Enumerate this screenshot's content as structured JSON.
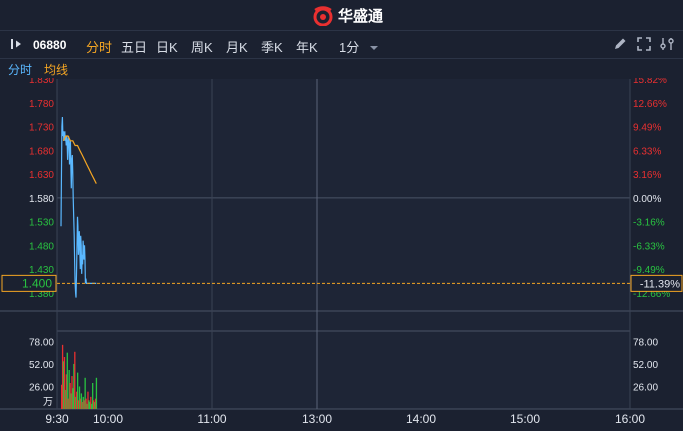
{
  "app": {
    "brand_name": "华盛通"
  },
  "toolbar": {
    "stock_code": "06880",
    "period_tabs": [
      {
        "label": "分时",
        "active": true
      },
      {
        "label": "五日",
        "active": false
      },
      {
        "label": "日K",
        "active": false
      },
      {
        "label": "周K",
        "active": false
      },
      {
        "label": "月K",
        "active": false
      },
      {
        "label": "季K",
        "active": false
      },
      {
        "label": "年K",
        "active": false
      }
    ],
    "interval": "1分",
    "icons": [
      "panel-toggle-icon",
      "pencil-icon",
      "fullscreen-icon",
      "settings-icon"
    ]
  },
  "legend": {
    "time_label": "分时",
    "avg_label": "均线"
  },
  "colors": {
    "up": "#e93030",
    "down": "#29c341",
    "price": "#5ab8ff",
    "avg": "#f5a623",
    "flat": "#e2e6ee"
  },
  "chart_data": {
    "type": "line",
    "price_axis": {
      "ticks": [
        "1.830",
        "1.780",
        "1.730",
        "1.680",
        "1.630",
        "1.580",
        "1.530",
        "1.480",
        "1.430",
        "1.380"
      ],
      "tick_values": [
        1.83,
        1.78,
        1.73,
        1.68,
        1.63,
        1.58,
        1.53,
        1.48,
        1.43,
        1.38
      ],
      "ylim": [
        1.365,
        1.83
      ],
      "prev_close": 1.58
    },
    "percent_axis": {
      "ticks": [
        "15.82%",
        "12.66%",
        "9.49%",
        "6.33%",
        "3.16%",
        "0.00%",
        "-3.16%",
        "-6.33%",
        "-9.49%",
        "-12.66%"
      ]
    },
    "current_price": "1.400",
    "current_change": "-11.39%",
    "x_ticks": [
      "9:30",
      "10:00",
      "11:00",
      "13:00",
      "14:00",
      "15:00",
      "16:00"
    ],
    "volume_axis": {
      "ticks": [
        "78.00",
        "52.00",
        "26.00"
      ],
      "tick_values": [
        78,
        52,
        26
      ],
      "unit": "万",
      "ylim": [
        0,
        90
      ]
    },
    "series": [
      {
        "name": "分时",
        "x": [
          0,
          1,
          2,
          3,
          4,
          5,
          6,
          7,
          8,
          9,
          10,
          11,
          12,
          13,
          14,
          15,
          16,
          17,
          18,
          19,
          20,
          21,
          22,
          23,
          24,
          25,
          26,
          27,
          28,
          29,
          30,
          31,
          32,
          33,
          34,
          35,
          36,
          37,
          38,
          39,
          40,
          41,
          42,
          43,
          44,
          45,
          46,
          47,
          48,
          49,
          50,
          51,
          52,
          53,
          54,
          55,
          56,
          57,
          58,
          59,
          60,
          61,
          62,
          63,
          64,
          65,
          66,
          67,
          68,
          69,
          70,
          71,
          72,
          73,
          74,
          75
        ],
        "values": [
          1.52,
          1.64,
          1.73,
          1.75,
          1.71,
          1.72,
          1.7,
          1.71,
          1.72,
          1.7,
          1.71,
          1.69,
          1.71,
          1.7,
          1.66,
          1.69,
          1.71,
          1.7,
          1.65,
          1.68,
          1.7,
          1.64,
          1.6,
          1.66,
          1.67,
          1.63,
          1.58,
          1.54,
          1.5,
          1.45,
          1.4,
          1.38,
          1.37,
          1.42,
          1.48,
          1.54,
          1.52,
          1.46,
          1.49,
          1.51,
          1.47,
          1.43,
          1.5,
          1.48,
          1.42,
          1.46,
          1.44,
          1.49,
          1.47,
          1.45,
          1.48,
          1.45,
          1.4,
          1.41,
          1.4,
          1.4,
          1.4,
          1.4,
          1.4,
          1.4,
          1.4,
          1.4,
          1.4,
          1.4,
          1.4,
          1.4,
          1.4,
          1.4,
          1.4,
          1.4,
          1.4,
          1.4,
          1.4,
          1.4,
          1.4,
          1.4
        ]
      },
      {
        "name": "均线",
        "x": [
          5,
          10,
          15,
          20,
          25,
          30,
          35,
          40,
          45,
          50,
          55,
          60,
          65,
          70,
          75
        ],
        "values": [
          1.7,
          1.71,
          1.71,
          1.7,
          1.7,
          1.69,
          1.69,
          1.68,
          1.67,
          1.66,
          1.65,
          1.64,
          1.63,
          1.62,
          1.61
        ]
      }
    ],
    "volume": {
      "x": [
        0,
        2,
        4,
        6,
        8,
        10,
        12,
        14,
        16,
        18,
        20,
        22,
        24,
        26,
        28,
        30,
        32,
        34,
        36,
        38,
        40,
        42,
        44,
        46,
        48,
        50,
        52,
        54,
        56,
        58,
        60,
        62,
        64,
        66,
        68,
        70,
        72,
        74
      ],
      "values": [
        28,
        74,
        55,
        60,
        22,
        40,
        65,
        12,
        45,
        30,
        18,
        38,
        24,
        52,
        66,
        14,
        20,
        42,
        10,
        26,
        12,
        18,
        8,
        14,
        10,
        36,
        12,
        6,
        20,
        10,
        8,
        14,
        6,
        30,
        10,
        8,
        12,
        36
      ],
      "up": [
        1,
        1,
        0,
        1,
        0,
        1,
        0,
        1,
        0,
        1,
        0,
        1,
        0,
        0,
        1,
        0,
        1,
        0,
        1,
        0,
        1,
        0,
        1,
        0,
        1,
        0,
        1,
        0,
        1,
        0,
        0,
        1,
        0,
        0,
        1,
        0,
        1,
        0
      ]
    },
    "grid": true
  }
}
